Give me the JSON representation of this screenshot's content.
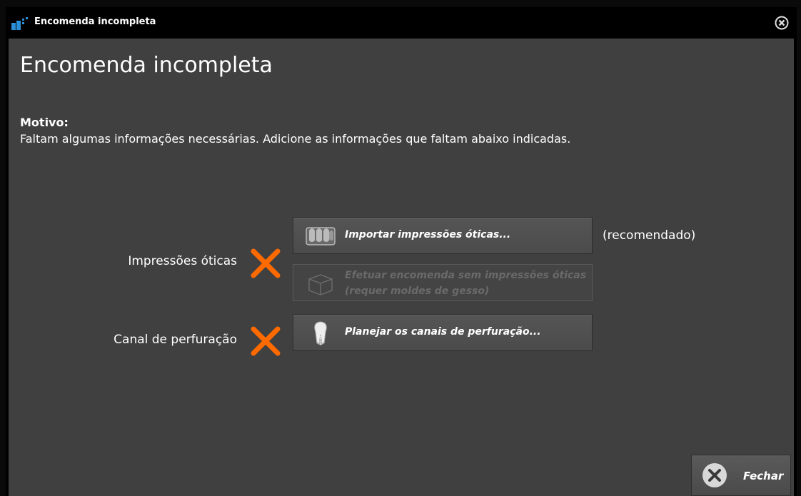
{
  "window": {
    "title": "Encomenda incompleta",
    "close_icon": "close-circle-icon"
  },
  "main": {
    "heading": "Encomenda incompleta",
    "reason_label": "Motivo:",
    "reason_text": "Faltam algumas informações necessárias. Adicione as informações que faltam abaixo indicadas."
  },
  "items": [
    {
      "label": "Impressões óticas",
      "status": "missing",
      "status_icon": "x-mark-icon",
      "status_color": "#ff6a00",
      "actions": [
        {
          "label": "Importar impressões óticas...",
          "icon": "optical-impressions-icon",
          "enabled": true,
          "note": "(recomendado)"
        },
        {
          "label": "Efetuar encomenda sem impressões óticas\n(requer moldes de gesso)",
          "icon": "box-icon",
          "enabled": false
        }
      ]
    },
    {
      "label": "Canal de perfuração",
      "status": "missing",
      "status_icon": "x-mark-icon",
      "status_color": "#ff6a00",
      "actions": [
        {
          "label": "Planejar os canais de perfuração...",
          "icon": "tooth-implant-icon",
          "enabled": true
        }
      ]
    }
  ],
  "footer": {
    "close_label": "Fechar",
    "close_icon": "close-circle-icon"
  },
  "colors": {
    "accent_x": "#ff6a00",
    "panel_bg": "#404040",
    "titlebar_bg": "#000000"
  }
}
